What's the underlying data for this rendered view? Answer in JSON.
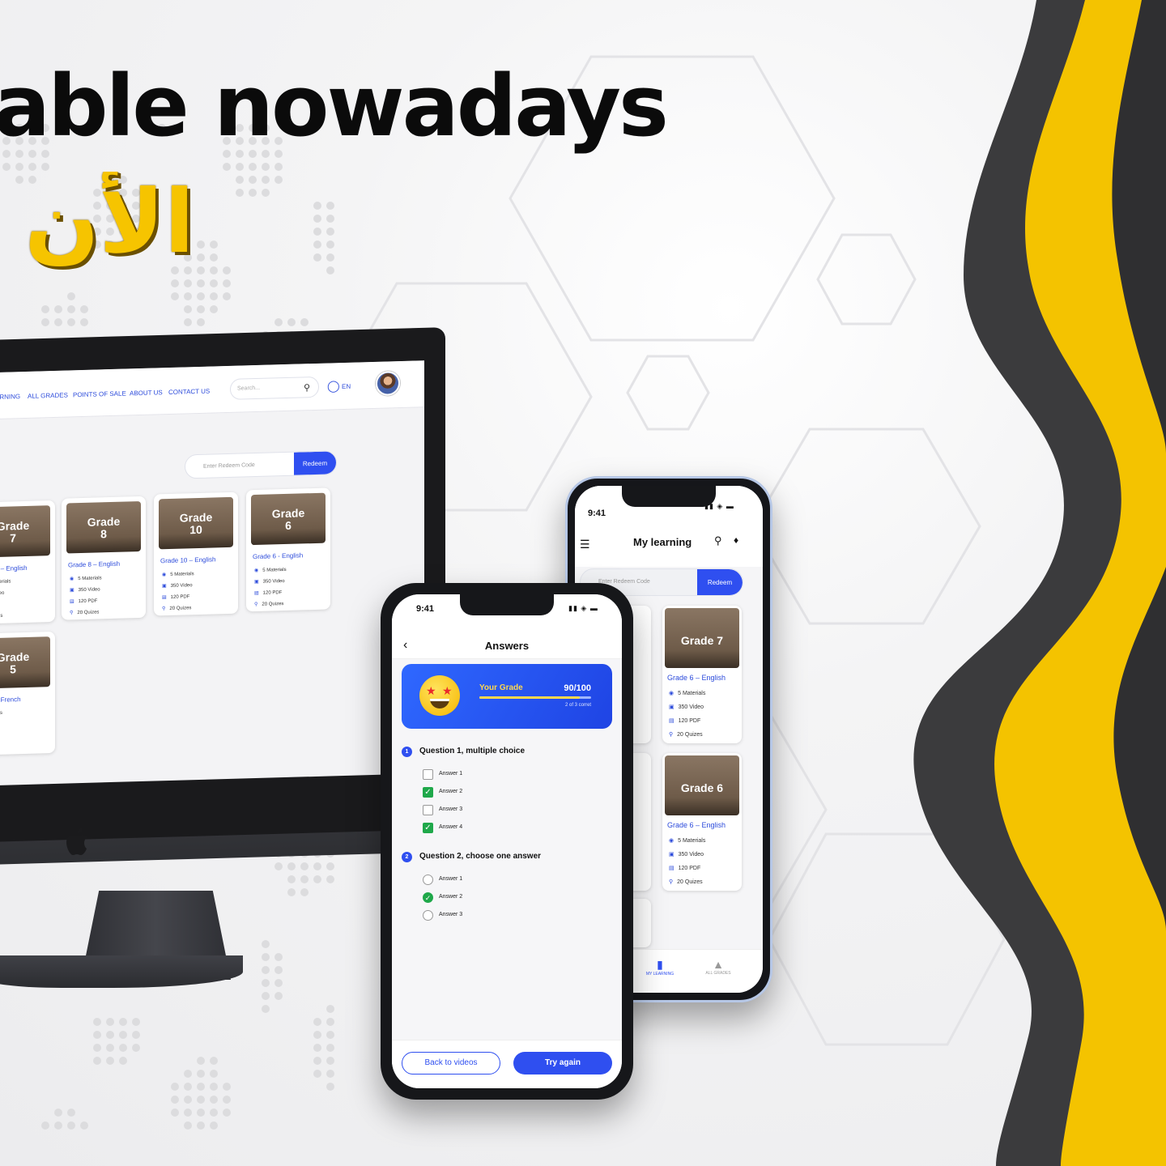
{
  "headline": "able nowadays",
  "arabic_headline": "الأن أ",
  "colors": {
    "brand_yellow": "#f6c400",
    "brand_dark": "#3a3a3a",
    "accent_blue": "#2f4ff0",
    "check_green": "#1fa84a"
  },
  "web": {
    "nav_links": [
      "ARNING",
      "ALL GRADES",
      "POINTS OF SALE",
      "ABOUT US",
      "CONTACT US"
    ],
    "search_placeholder": "Search...",
    "lang": "EN",
    "redeem_placeholder": "Enter Redeem Code",
    "redeem_button": "Redeem",
    "cards": [
      {
        "thumb": "Grade\n7",
        "title": "7 – English",
        "stats": [
          "aterials",
          "ideo",
          "F",
          "zes"
        ]
      },
      {
        "thumb": "Grade\n8",
        "title": "Grade 8 – English",
        "stats": [
          "5 Materials",
          "350 Video",
          "120 PDF",
          "20 Quizes"
        ]
      },
      {
        "thumb": "Grade\n10",
        "title": "Grade 10 – English",
        "stats": [
          "5 Materials",
          "350 Video",
          "120 PDF",
          "20 Quizes"
        ]
      },
      {
        "thumb": "Grade\n6",
        "title": "Grade 6 - English",
        "stats": [
          "5 Materials",
          "350 Video",
          "120 PDF",
          "20 Quizes"
        ]
      },
      {
        "thumb": "Grade\n5",
        "title": "– French",
        "stats": [
          "ials",
          "o",
          "",
          "s"
        ]
      }
    ]
  },
  "phone_back": {
    "time": "9:41",
    "title": "My learning",
    "redeem_placeholder": "Enter Redeem Code",
    "redeem_button": "Redeem",
    "cards": [
      {
        "thumb": "Grade 7",
        "title": "Grade 6 – English",
        "stats": [
          "5 Materials",
          "350 Video",
          "120 PDF",
          "20 Quizes"
        ]
      },
      {
        "thumb": "Grade 6",
        "title": "Grade 6 – English",
        "stats": [
          "5 Materials",
          "350 Video",
          "120 PDF",
          "20 Quizes"
        ]
      }
    ],
    "tabs": [
      "MY LEARNING",
      "ALL GRADES"
    ]
  },
  "phone_front": {
    "time": "9:41",
    "title": "Answers",
    "grade_label": "Your Grade",
    "grade_score": "90/100",
    "grade_progress": 0.9,
    "grade_sub": "2 of 3 corret",
    "q1": {
      "num": "1",
      "text": "Question  1, multiple choice",
      "options": [
        "Answer 1",
        "Answer 2",
        "Answer 3",
        "Answer 4"
      ]
    },
    "q2": {
      "num": "2",
      "text": "Question  2, choose one answer",
      "options": [
        "Answer 1",
        "Answer 2",
        "Answer 3"
      ]
    },
    "back_button": "Back to videos",
    "try_button": "Try again"
  }
}
